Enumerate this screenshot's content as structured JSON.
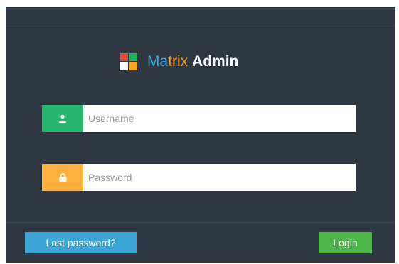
{
  "brand": {
    "part1": "Ma",
    "part2": "trix",
    "part3": "Admin",
    "colors": {
      "ma": "#3ea6df",
      "trix": "#f39c12",
      "admin": "#ffffff"
    }
  },
  "form": {
    "username": {
      "placeholder": "Username",
      "value": "",
      "icon": "user-icon",
      "addon_color": "#27b56c"
    },
    "password": {
      "placeholder": "Password",
      "value": "",
      "icon": "lock-icon",
      "addon_color": "#fbb040"
    }
  },
  "actions": {
    "lost_password": {
      "label": "Lost password?",
      "color": "#3aa7d8"
    },
    "login": {
      "label": "Login",
      "color": "#4cb748"
    }
  },
  "theme": {
    "panel_background": "#2f3742"
  }
}
